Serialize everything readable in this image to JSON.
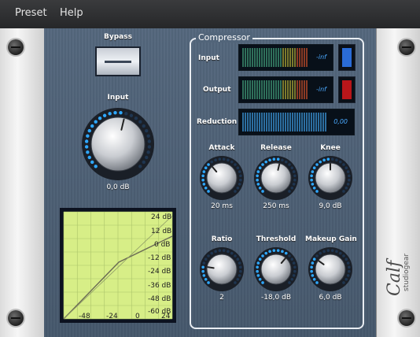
{
  "menu": {
    "preset": "Preset",
    "help": "Help"
  },
  "bypass": {
    "label": "Bypass"
  },
  "input_knob": {
    "label": "Input",
    "value": "0,0 dB",
    "level": 0.55
  },
  "compressor": {
    "title": "Compressor",
    "meters": [
      {
        "label": "Input",
        "readout": "-inf",
        "led_color": "#2a6bd6"
      },
      {
        "label": "Output",
        "readout": "-inf",
        "led_color": "#b8161a"
      },
      {
        "label": "Reduction",
        "readout": "0,00"
      }
    ],
    "knobs": [
      {
        "label": "Attack",
        "value": "20 ms",
        "level": 0.35
      },
      {
        "label": "Release",
        "value": "250 ms",
        "level": 0.55
      },
      {
        "label": "Knee",
        "value": "9,0 dB",
        "level": 0.5
      },
      {
        "label": "Ratio",
        "value": "2",
        "level": 0.2
      },
      {
        "label": "Threshold",
        "value": "-18,0 dB",
        "level": 0.65
      },
      {
        "label": "Makeup Gain",
        "value": "6,0 dB",
        "level": 0.3
      }
    ]
  },
  "graph": {
    "y_ticks": [
      "24 dB",
      "12 dB",
      "0 dB",
      "-12 dB",
      "-24 dB",
      "-36 dB",
      "-48 dB",
      "-60 dB"
    ],
    "x_ticks": [
      "-48",
      "-24",
      "0",
      "24"
    ],
    "curve_color": "#6b6b55",
    "bg_color": "#d7ee87"
  },
  "logo": {
    "text": "Calf",
    "subtext": "studiogear"
  }
}
